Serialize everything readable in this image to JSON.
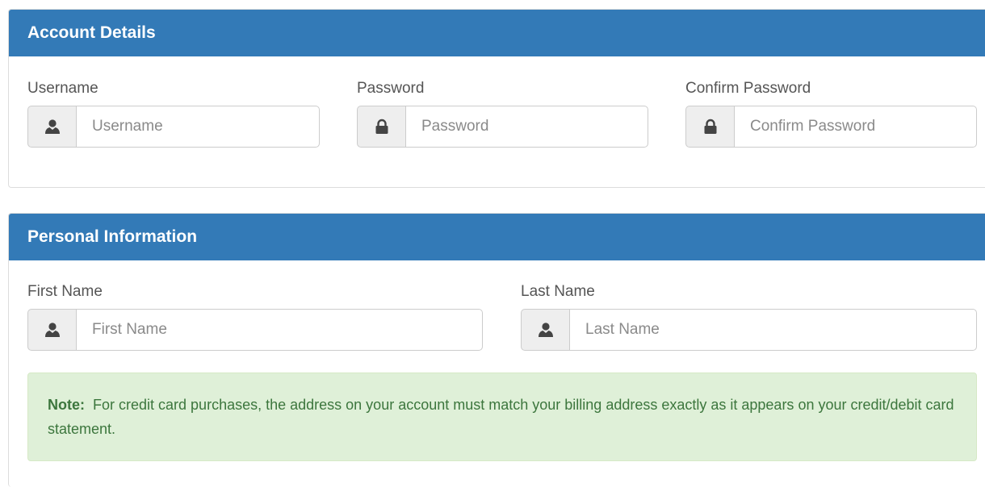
{
  "account": {
    "title": "Account Details",
    "username": {
      "label": "Username",
      "placeholder": "Username",
      "value": ""
    },
    "password": {
      "label": "Password",
      "placeholder": "Password",
      "value": ""
    },
    "confirm_password": {
      "label": "Confirm Password",
      "placeholder": "Confirm Password",
      "value": ""
    }
  },
  "personal": {
    "title": "Personal Information",
    "first_name": {
      "label": "First Name",
      "placeholder": "First Name",
      "value": ""
    },
    "last_name": {
      "label": "Last Name",
      "placeholder": "Last Name",
      "value": ""
    },
    "note": {
      "prefix": "Note:",
      "text": "For credit card purchases, the address on your account must match your billing address exactly as it appears on your credit/debit card statement."
    }
  },
  "icons": {
    "user": "user-icon",
    "lock": "lock-icon"
  },
  "colors": {
    "panel_heading_bg": "#337ab7",
    "panel_heading_text": "#ffffff",
    "note_bg": "#dff0d8",
    "note_text": "#3c763d",
    "addon_bg": "#eeeeee",
    "icon_color": "#444444"
  }
}
